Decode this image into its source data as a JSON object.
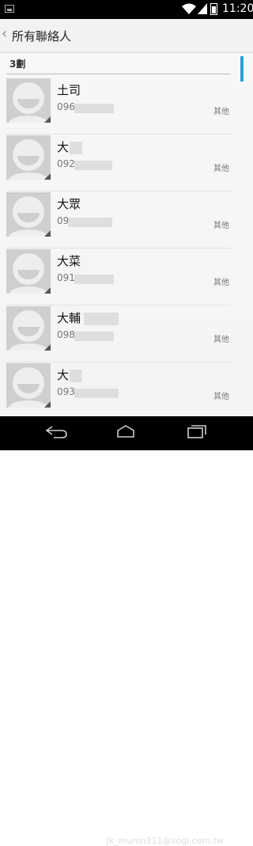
{
  "status_bar": {
    "time": "11:20"
  },
  "header": {
    "title": "所有聯絡人"
  },
  "section": {
    "label": "3劃"
  },
  "contacts": [
    {
      "name": "土司",
      "phone": "096",
      "type": "其他"
    },
    {
      "name": "大",
      "phone": "092",
      "type": "其他"
    },
    {
      "name": "大眾",
      "phone": "09",
      "type": "其他"
    },
    {
      "name": "大菜",
      "phone": "091",
      "type": "其他"
    },
    {
      "name": "大輔",
      "phone": "098",
      "type": "其他"
    },
    {
      "name": "大",
      "phone": "093",
      "type": "其他"
    }
  ],
  "watermark": "jk_munin111@sogi.com.tw"
}
